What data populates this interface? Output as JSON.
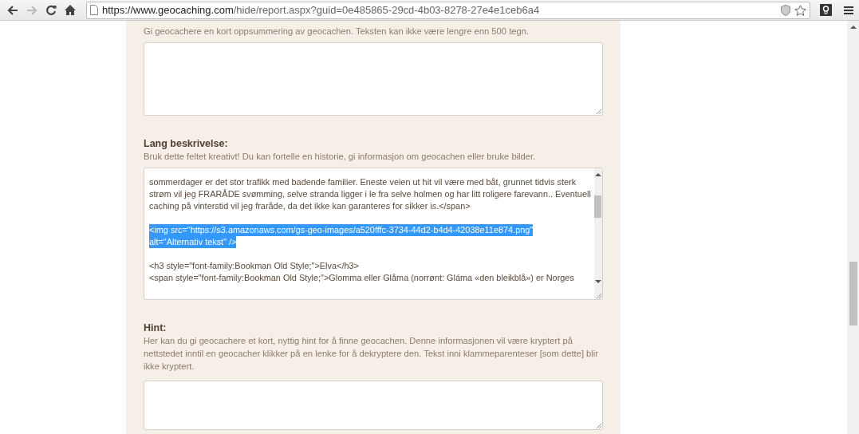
{
  "browser": {
    "url_host": "https://www.geocaching.com",
    "url_rest": "/hide/report.aspx?guid=0e485865-29cd-4b03-8278-27e4e1ceb6a4",
    "forward_disabled": true
  },
  "short_description": {
    "help": "Gi geocachere en kort oppsummering av geocachen. Teksten kan ikke være lengre enn 500 tegn."
  },
  "long_description": {
    "label": "Lang beskrivelse:",
    "help": "Bruk dette feltet kreativt! Du kan fortelle en historie, gi informasjon om geocachen eller bruke bilder.",
    "blocks": [
      {
        "selected": false,
        "lines": [
          "sommerdager er det stor trafikk med badende familier. Eneste veien ut hit vil være med båt, grunnet tidvis sterk",
          "strøm vil jeg FRARÅDE svømming, selve stranda ligger i le fra selve holmen og har litt roligere farevann.. Eventuell",
          "caching på vinterstid vil jeg  fraråde, da det ikke kan garanteres for sikker is.</span>"
        ]
      },
      {
        "selected": true,
        "lines": [
          "<img src=\"https://s3.amazonaws.com/gs-geo-images/a520fffc-3734-44d2-b4d4-42038e11e874.png\"",
          "alt=\"Alternativ tekst\" />"
        ]
      },
      {
        "selected": false,
        "lines": [
          "<h3 style=\"font-family:Bookman Old Style;\">Elva</h3>",
          "<span style=\"font-family:Bookman Old Style;\">Glomma eller Glåma (norrønt: Gláma «den bleikblå») er Norges"
        ]
      }
    ]
  },
  "hint": {
    "label": "Hint:",
    "help": "Her kan du gi geocachere et kort, nyttig hint for å finne geocachen. Denne informasjonen vil være kryptert på nettstedet inntil en geocacher klikker på en lenke for å dekryptere den. Tekst inni klammeparenteser [som dette] blir ikke kryptert."
  }
}
